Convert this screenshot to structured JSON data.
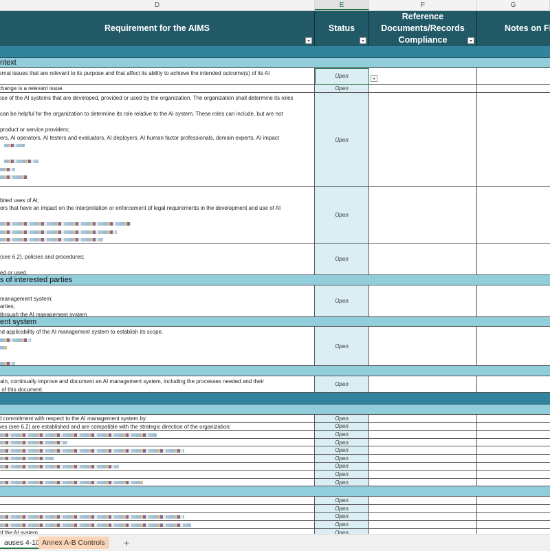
{
  "column_letters": {
    "d": "D",
    "e": "E",
    "f": "F",
    "g": "G"
  },
  "header": {
    "requirement": "Requirement for the AIMS",
    "status": "Status",
    "reference": "Reference Documents/Records Compliance",
    "notes": "Notes on Fi"
  },
  "sections": {
    "context": "ntext",
    "interested": "s of interested parties",
    "mgmt": "ent system"
  },
  "rows": {
    "r1": "ernal issues that are relevant to its purpose and that affect its ability to achieve the intended outcome(s) of its AI",
    "r2": "change is a relevant issue.",
    "r3": "ose of the AI systems that are developed, provided or used by the organization. The organization shall determine its roles\n\ncan be helpful for the organization to determine its role relative to the AI system. These roles can include, but are not\n\nproduct or service providers;\ners, AI operators, AI testers and evaluators, AI deployers, AI human factor professionals, domain experts, AI impact",
    "r4": "\nbited uses of AI;\nors that have an impact on the interpretation or enforcement of legal requirements in the development and use of AI",
    "r5": "\n(see 6.2), policies and procedures;\n\ned or used.",
    "r6": "\nmanagement system;\narties;\nthrough the AI management system",
    "r7": "nd applicability of the AI management system to establish its scope.",
    "r8": "tain, continually improve and document an AI management system, including the processes needed and their\n of this document.",
    "r9": "d commitment with respect to the AI management system by:",
    "r10": "ves (see 6.2) are established and are compatible with the strategic direction of the organization;",
    "r_last": "of the AI system"
  },
  "status_value": "Open",
  "tabs": {
    "active": "auses 4-10",
    "second": "Annex A-B Controls",
    "add": "+"
  },
  "colors": {
    "header": "#215967",
    "band_dark": "#31849b",
    "band_light": "#92cddc",
    "status_fill": "#daeef3",
    "tab_orange": "#fbd5b5",
    "selection": "#217346"
  }
}
